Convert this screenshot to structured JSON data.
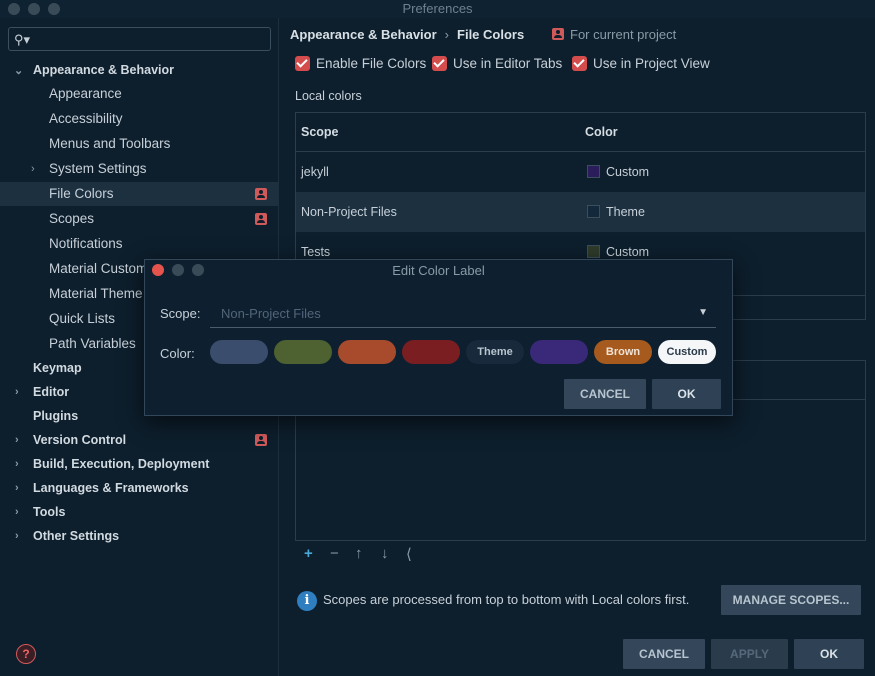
{
  "window": {
    "title": "Preferences"
  },
  "search": {
    "placeholder": ""
  },
  "sidebar": {
    "items": [
      {
        "label": "Appearance & Behavior",
        "bold": true,
        "expanded": true
      },
      {
        "label": "Appearance"
      },
      {
        "label": "Accessibility"
      },
      {
        "label": "Menus and Toolbars"
      },
      {
        "label": "System Settings",
        "collapsed": true
      },
      {
        "label": "File Colors",
        "selected": true,
        "project_icon": true
      },
      {
        "label": "Scopes",
        "project_icon": true
      },
      {
        "label": "Notifications"
      },
      {
        "label": "Material Custom"
      },
      {
        "label": "Material Theme"
      },
      {
        "label": "Quick Lists"
      },
      {
        "label": "Path Variables"
      },
      {
        "label": "Keymap",
        "bold": true
      },
      {
        "label": "Editor",
        "bold": true,
        "collapsed": true
      },
      {
        "label": "Plugins",
        "bold": true
      },
      {
        "label": "Version Control",
        "bold": true,
        "collapsed": true,
        "project_icon": true
      },
      {
        "label": "Build, Execution, Deployment",
        "bold": true,
        "collapsed": true
      },
      {
        "label": "Languages & Frameworks",
        "bold": true,
        "collapsed": true
      },
      {
        "label": "Tools",
        "bold": true,
        "collapsed": true
      },
      {
        "label": "Other Settings",
        "bold": true,
        "collapsed": true
      }
    ]
  },
  "header": {
    "breadcrumb_parent": "Appearance & Behavior",
    "breadcrumb_current": "File Colors",
    "scope_note": "For current project"
  },
  "options": {
    "enable_file_colors": "Enable File Colors",
    "use_in_editor_tabs": "Use in Editor Tabs",
    "use_in_project_view": "Use in Project View"
  },
  "local_colors": {
    "title": "Local colors",
    "columns": [
      "Scope",
      "Color"
    ],
    "rows": [
      {
        "scope": "jekyll",
        "color": "Custom",
        "swatch": "#2b1d5c"
      },
      {
        "scope": "Non-Project Files",
        "color": "Theme",
        "swatch": "#13283a"
      },
      {
        "scope": "Tests",
        "color": "Custom",
        "swatch": "#2e3a2a"
      }
    ]
  },
  "shared_colors": {
    "empty_text": ""
  },
  "toolbar_icons": [
    "plus-icon",
    "minus-icon",
    "arrow-up-icon",
    "arrow-down-icon",
    "share-icon"
  ],
  "info": {
    "text": "Scopes are processed from top to bottom with Local colors first."
  },
  "buttons": {
    "manage_scopes": "MANAGE SCOPES...",
    "cancel": "CANCEL",
    "apply": "APPLY",
    "ok": "OK"
  },
  "dialog": {
    "title": "Edit Color Label",
    "scope_label": "Scope:",
    "scope_value": "Non-Project Files",
    "color_label": "Color:",
    "colors": [
      {
        "label": "",
        "bg": "#3a4d6c"
      },
      {
        "label": "",
        "bg": "#4d6230"
      },
      {
        "label": "",
        "bg": "#a84a2c"
      },
      {
        "label": "",
        "bg": "#7a1e22"
      },
      {
        "label": "Theme",
        "bg": "#17293a"
      },
      {
        "label": "",
        "bg": "#3a2878"
      },
      {
        "label": "Brown",
        "bg": "#a65a1e"
      },
      {
        "label": "Custom",
        "bg": "#f4f6f8",
        "selected": true
      }
    ],
    "cancel": "CANCEL",
    "ok": "OK"
  },
  "colors": {
    "accent": "#d44c4c",
    "background": "#0d1e2c",
    "selection": "#1c3040"
  }
}
